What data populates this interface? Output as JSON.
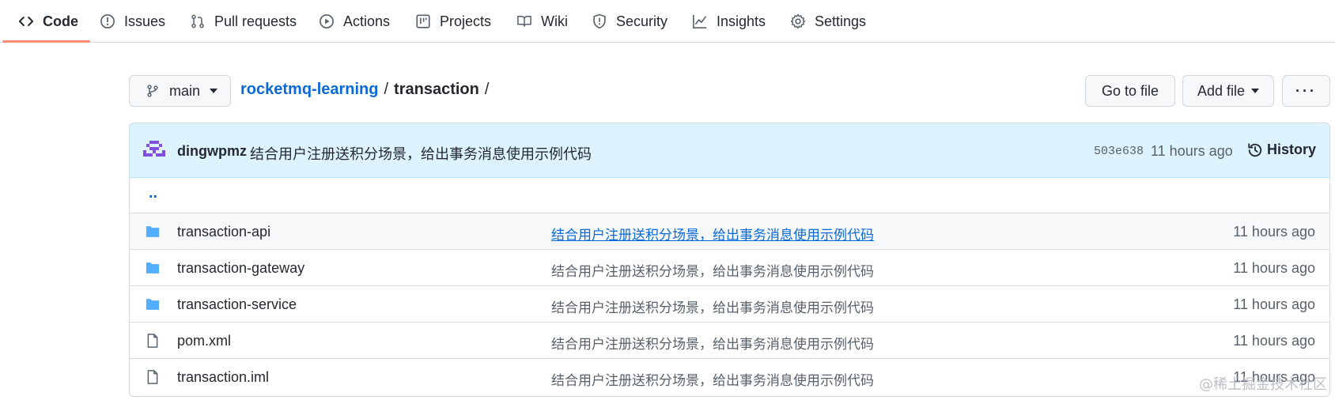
{
  "nav": {
    "tabs": [
      {
        "label": "Code",
        "icon": "code-icon",
        "active": true
      },
      {
        "label": "Issues",
        "icon": "issue-icon"
      },
      {
        "label": "Pull requests",
        "icon": "pull-request-icon"
      },
      {
        "label": "Actions",
        "icon": "play-icon"
      },
      {
        "label": "Projects",
        "icon": "table-icon"
      },
      {
        "label": "Wiki",
        "icon": "book-icon"
      },
      {
        "label": "Security",
        "icon": "shield-icon"
      },
      {
        "label": "Insights",
        "icon": "graph-icon"
      },
      {
        "label": "Settings",
        "icon": "gear-icon"
      }
    ],
    "active_underline_color": "#fd8c73"
  },
  "branch": {
    "name": "main"
  },
  "breadcrumb": {
    "repo": "rocketmq-learning",
    "sep1": "/",
    "current": "transaction",
    "sep2": "/"
  },
  "actions": {
    "go_to_file": "Go to file",
    "add_file": "Add file",
    "more": "···"
  },
  "commit": {
    "author": "dingwpmz",
    "message": "结合用户注册送积分场景，给出事务消息使用示例代码",
    "sha": "503e638",
    "time": "11 hours ago",
    "history_label": "History"
  },
  "parent_dir": "..",
  "files": [
    {
      "name": "transaction-api",
      "type": "folder",
      "message": "结合用户注册送积分场景，给出事务消息使用示例代码",
      "time": "11 hours ago"
    },
    {
      "name": "transaction-gateway",
      "type": "folder",
      "message": "结合用户注册送积分场景，给出事务消息使用示例代码",
      "time": "11 hours ago"
    },
    {
      "name": "transaction-service",
      "type": "folder",
      "message": "结合用户注册送积分场景，给出事务消息使用示例代码",
      "time": "11 hours ago"
    },
    {
      "name": "pom.xml",
      "type": "file",
      "message": "结合用户注册送积分场景，给出事务消息使用示例代码",
      "time": "11 hours ago"
    },
    {
      "name": "transaction.iml",
      "type": "file",
      "message": "结合用户注册送积分场景，给出事务消息使用示例代码",
      "time": "11 hours ago"
    }
  ],
  "watermark": "@稀土掘金技术社区",
  "colors": {
    "link": "#0969da",
    "folder": "#54aeff",
    "commit_bg": "#ddf4ff",
    "text_muted": "#57606a"
  }
}
